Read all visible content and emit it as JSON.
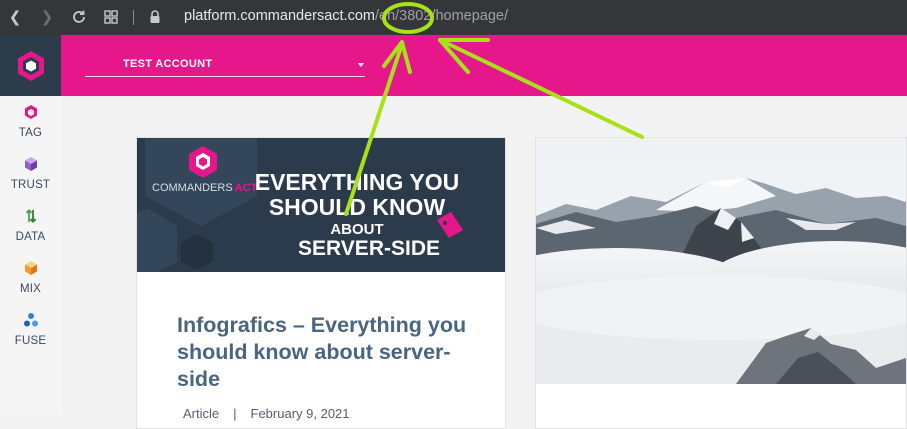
{
  "browser": {
    "url_host": "platform.commandersact.com",
    "url_path": "/en/3802/homepage/"
  },
  "sidebar": {
    "items": [
      {
        "label": "TAG",
        "icon": "tag-hexagon-icon",
        "color": "#e5178b"
      },
      {
        "label": "TRUST",
        "icon": "trust-cube-icon",
        "color": "#8f5fc7"
      },
      {
        "label": "DATA",
        "icon": "data-arrows-icon",
        "color": "#4aa64a"
      },
      {
        "label": "MIX",
        "icon": "mix-cube-icon",
        "color": "#f49b2a"
      },
      {
        "label": "FUSE",
        "icon": "fuse-nodes-icon",
        "color": "#2d84d6"
      }
    ]
  },
  "topbar": {
    "account_label": "TEST ACCOUNT",
    "accent": "#e5178b"
  },
  "cards": [
    {
      "banner": {
        "brand_prefix": "COMMANDERS",
        "brand_suffix": "ACT",
        "headline_1": "EVERYTHING YOU",
        "headline_2": "SHOULD KNOW",
        "headline_3": "ABOUT",
        "headline_4": "SERVER-SIDE"
      },
      "title": "Infografics – Everything you should know about server-side",
      "category": "Article",
      "divider": "|",
      "date": "February 9, 2021"
    },
    {
      "image": "mountain-photo"
    }
  ]
}
